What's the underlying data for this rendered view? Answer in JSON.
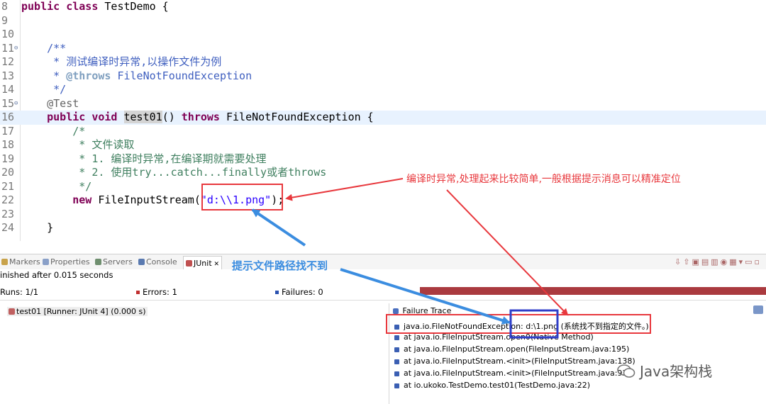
{
  "editor": {
    "lines": [
      {
        "n": "8",
        "fold": "",
        "current": false,
        "segs": [
          [
            "kw",
            "public "
          ],
          [
            "kw",
            "class "
          ],
          [
            "",
            "TestDemo {"
          ]
        ]
      },
      {
        "n": "9",
        "fold": "",
        "current": false,
        "segs": []
      },
      {
        "n": "10",
        "fold": "",
        "current": false,
        "segs": []
      },
      {
        "n": "11",
        "fold": "⊖",
        "current": false,
        "segs": [
          [
            "jd",
            "    /**"
          ]
        ]
      },
      {
        "n": "12",
        "fold": "",
        "current": false,
        "segs": [
          [
            "jd",
            "     * 测试编译时异常,以操作文件为例"
          ]
        ]
      },
      {
        "n": "13",
        "fold": "",
        "current": false,
        "segs": [
          [
            "jd",
            "     * "
          ],
          [
            "tag",
            "@throws"
          ],
          [
            "jd",
            " FileNotFoundException"
          ]
        ]
      },
      {
        "n": "14",
        "fold": "",
        "current": false,
        "segs": [
          [
            "jd",
            "     */"
          ]
        ]
      },
      {
        "n": "15",
        "fold": "⊖",
        "current": false,
        "segs": [
          [
            "ann",
            "    @Test"
          ]
        ]
      },
      {
        "n": "16",
        "fold": "",
        "current": true,
        "segs": [
          [
            "kw",
            "    public "
          ],
          [
            "kw",
            "void "
          ],
          [
            "mark",
            "test01"
          ],
          [
            "",
            "() "
          ],
          [
            "kw",
            "throws "
          ],
          [
            "",
            "FileNotFoundException {"
          ]
        ]
      },
      {
        "n": "17",
        "fold": "",
        "current": false,
        "segs": [
          [
            "cm",
            "        /*"
          ]
        ]
      },
      {
        "n": "18",
        "fold": "",
        "current": false,
        "segs": [
          [
            "cm",
            "         * 文件读取"
          ]
        ]
      },
      {
        "n": "19",
        "fold": "",
        "current": false,
        "segs": [
          [
            "cm",
            "         * 1. 编译时异常,在编译期就需要处理"
          ]
        ]
      },
      {
        "n": "20",
        "fold": "",
        "current": false,
        "segs": [
          [
            "cm",
            "         * 2. 使用try...catch...finally或者throws"
          ]
        ]
      },
      {
        "n": "21",
        "fold": "",
        "current": false,
        "segs": [
          [
            "cm",
            "         */"
          ]
        ]
      },
      {
        "n": "22",
        "fold": "",
        "current": false,
        "segs": [
          [
            "kw",
            "        new "
          ],
          [
            "",
            "FileInputStream("
          ],
          [
            "str",
            "\"d:\\\\1.png\""
          ],
          [
            "",
            ");"
          ]
        ]
      },
      {
        "n": "23",
        "fold": "",
        "current": false,
        "segs": []
      },
      {
        "n": "24",
        "fold": "",
        "current": false,
        "segs": [
          [
            "",
            "    }"
          ]
        ]
      }
    ]
  },
  "tabs": [
    {
      "id": "markers",
      "label": "Markers",
      "color": "#c8a24a",
      "active": false
    },
    {
      "id": "properties",
      "label": "Properties",
      "color": "#8aa0c8",
      "active": false
    },
    {
      "id": "servers",
      "label": "Servers",
      "color": "#6f8f6f",
      "active": false
    },
    {
      "id": "console",
      "label": "Console",
      "color": "#5a7ab0",
      "active": false
    },
    {
      "id": "junit",
      "label": "JUnit",
      "color": "#c05050",
      "active": true
    }
  ],
  "junit": {
    "status": "inished after 0.015 seconds",
    "runs_label": "Runs:",
    "runs_value": "1/1",
    "errors_label": "Errors:",
    "errors_value": "1",
    "failures_label": "Failures:",
    "failures_value": "0",
    "tree_item": "test01 [Runner: JUnit 4] (0.000 s)",
    "trace_title": "Failure Trace",
    "trace": [
      "java.io.FileNotFoundException: d:\\1.png (系统找不到指定的文件。)",
      "at java.io.FileInputStream.open0(Native Method)",
      "at java.io.FileInputStream.open(FileInputStream.java:195)",
      "at java.io.FileInputStream.<init>(FileInputStream.java:138)",
      "at java.io.FileInputStream.<init>(FileInputStream.java:93)",
      "at io.ukoko.TestDemo.test01(TestDemo.java:22)"
    ]
  },
  "annotations": {
    "red_note": "编译时异常,处理起来比较简单,一般根据提示消息可以精准定位",
    "blue_note": "提示文件路径找不到",
    "red_color": "#e8383d",
    "blue_color": "#3b8de0",
    "box_blue": "#2f3ec9"
  },
  "watermark": "Java架构栈"
}
